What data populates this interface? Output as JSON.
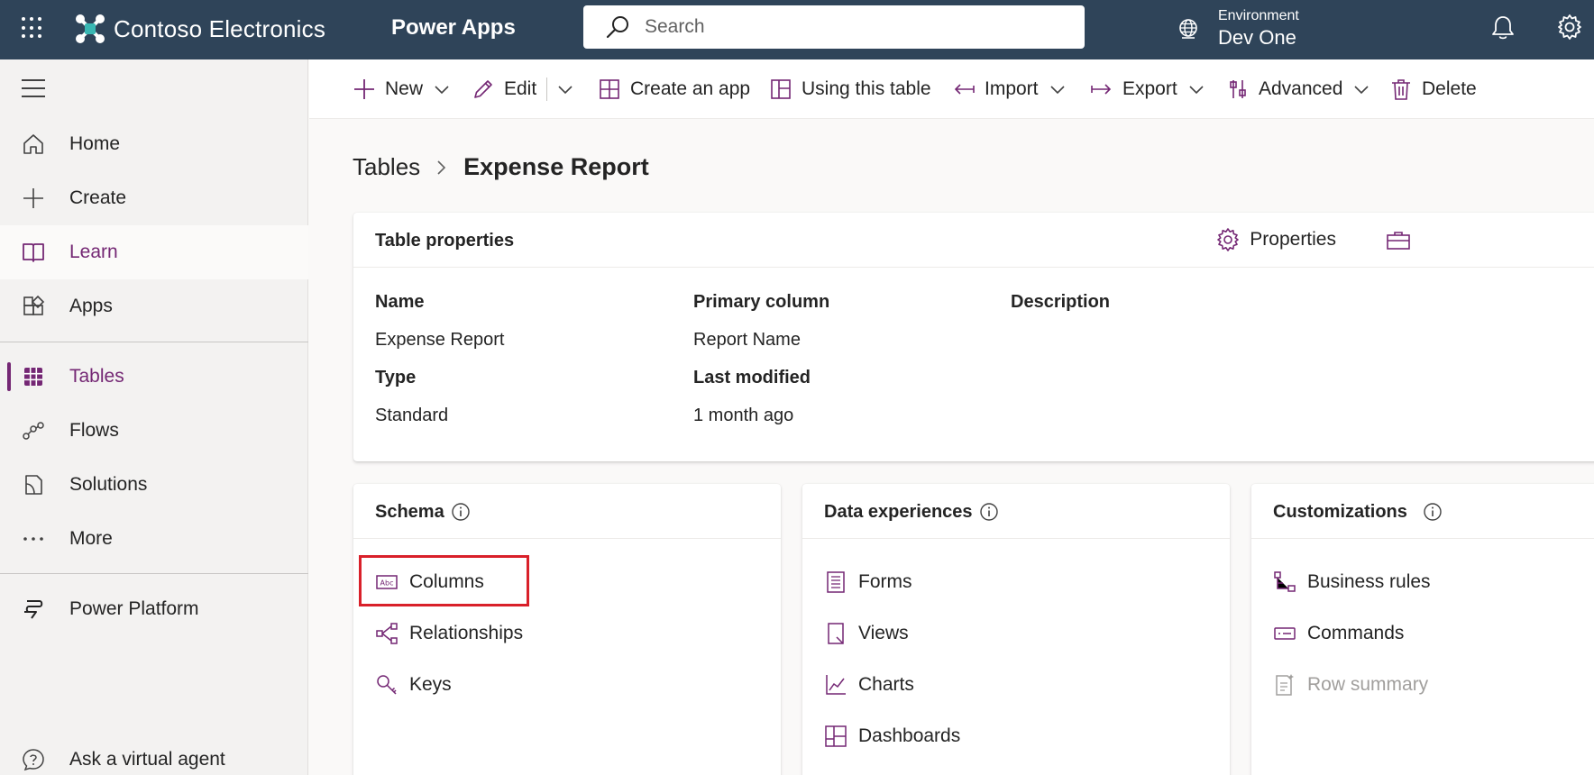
{
  "topbar": {
    "brand": "Contoso Electronics",
    "app": "Power Apps",
    "search_placeholder": "Search",
    "env_label": "Environment",
    "env_value": "Dev One"
  },
  "sidebar": {
    "items": [
      {
        "label": "Home",
        "icon": "home-icon"
      },
      {
        "label": "Create",
        "icon": "plus-icon"
      },
      {
        "label": "Learn",
        "icon": "book-icon"
      },
      {
        "label": "Apps",
        "icon": "apps-icon"
      },
      {
        "label": "Tables",
        "icon": "grid-icon"
      },
      {
        "label": "Flows",
        "icon": "flow-icon"
      },
      {
        "label": "Solutions",
        "icon": "solutions-icon"
      },
      {
        "label": "More",
        "icon": "more-icon"
      },
      {
        "label": "Power Platform",
        "icon": "power-platform-icon"
      },
      {
        "label": "Ask a virtual agent",
        "icon": "question-icon"
      }
    ]
  },
  "commandbar": {
    "new": "New",
    "edit": "Edit",
    "create_app": "Create an app",
    "using_table": "Using this table",
    "import": "Import",
    "export": "Export",
    "advanced": "Advanced",
    "delete": "Delete"
  },
  "breadcrumb": {
    "parent": "Tables",
    "current": "Expense Report"
  },
  "table_properties": {
    "title": "Table properties",
    "properties_button": "Properties",
    "name_label": "Name",
    "name_value": "Expense Report",
    "primary_label": "Primary column",
    "primary_value": "Report Name",
    "description_label": "Description",
    "type_label": "Type",
    "type_value": "Standard",
    "modified_label": "Last modified",
    "modified_value": "1 month ago"
  },
  "schema": {
    "title": "Schema",
    "items": [
      "Columns",
      "Relationships",
      "Keys"
    ]
  },
  "data_experiences": {
    "title": "Data experiences",
    "items": [
      "Forms",
      "Views",
      "Charts",
      "Dashboards"
    ]
  },
  "customizations": {
    "title": "Customizations",
    "items": [
      "Business rules",
      "Commands",
      "Row summary"
    ]
  },
  "colors": {
    "topbar": "#2f4459",
    "accent": "#742774",
    "highlight": "#d9202a"
  }
}
